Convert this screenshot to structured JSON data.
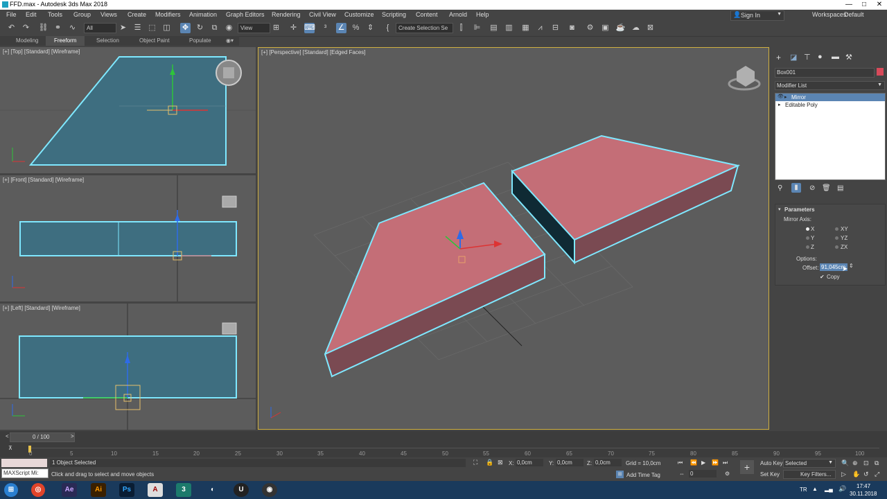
{
  "window": {
    "title": "FFD.max - Autodesk 3ds Max 2018",
    "controls": [
      "—",
      "□",
      "✕"
    ]
  },
  "menu": [
    "File",
    "Edit",
    "Tools",
    "Group",
    "Views",
    "Create",
    "Modifiers",
    "Animation",
    "Graph Editors",
    "Rendering",
    "Civil View",
    "Customize",
    "Scripting",
    "Content",
    "Arnold",
    "Help"
  ],
  "account": {
    "signin": "Sign In",
    "workspaces_label": "Workspaces:",
    "workspace": "Default"
  },
  "toolbar": {
    "selection_filter": "All",
    "ref_coord": "View",
    "selection_set": "Create Selection Se"
  },
  "ribbon": {
    "tabs": [
      "Modeling",
      "Freeform",
      "Selection",
      "Object Paint",
      "Populate"
    ],
    "active": "Freeform"
  },
  "viewports": {
    "top": "[+] [Top] [Standard] [Wireframe]",
    "front": "[+] [Front] [Standard] [Wireframe]",
    "left": "[+] [Left] [Standard] [Wireframe]",
    "perspective": "[+] [Perspective] [Standard] [Edged Faces]"
  },
  "command_panel": {
    "object_name": "Box001",
    "object_color": "#d84a5a",
    "modifier_list_label": "Modifier List",
    "stack": [
      "Mirror",
      "Editable Poly"
    ],
    "stack_selected": "Mirror",
    "parameters": {
      "rollout": "Parameters",
      "mirror_axis_label": "Mirror Axis:",
      "axes_left": [
        "X",
        "Y",
        "Z"
      ],
      "axes_right": [
        "XY",
        "YZ",
        "ZX"
      ],
      "selected_axis": "X",
      "options_label": "Options:",
      "offset_label": "Offset:",
      "offset_value": "91,045cm",
      "copy_label": "Copy",
      "copy_checked": true
    }
  },
  "timeline": {
    "frame_display": "0 / 100",
    "ticks": [
      "0",
      "5",
      "10",
      "15",
      "20",
      "25",
      "30",
      "35",
      "40",
      "45",
      "50",
      "55",
      "60",
      "65",
      "70",
      "75",
      "80",
      "85",
      "90",
      "95",
      "100"
    ]
  },
  "status": {
    "maxscript": "MAXScript Mi:",
    "selected": "1 Object Selected",
    "prompt": "Click and drag to select and move objects",
    "x_label": "X:",
    "x_value": "0,0cm",
    "y_label": "Y:",
    "y_value": "0,0cm",
    "z_label": "Z:",
    "z_value": "0,0cm",
    "grid": "Grid = 10,0cm",
    "add_time_tag": "Add Time Tag",
    "frame": "0",
    "auto_key": "Auto Key",
    "set_key": "Set Key",
    "selected_dropdown": "Selected",
    "key_filters": "Key Filters..."
  },
  "taskbar": {
    "apps": [
      "Ae",
      "Ai",
      "Ps",
      "A",
      "3",
      "U"
    ],
    "lang": "TR",
    "time": "17:47",
    "date": "30.11.2018"
  },
  "colors": {
    "accent": "#5b85b3",
    "selection_outline": "#7fe8ff",
    "box_face": "#c46e77",
    "wire_fill": "#3e6e80",
    "stack_highlight": "#5b85b3"
  }
}
